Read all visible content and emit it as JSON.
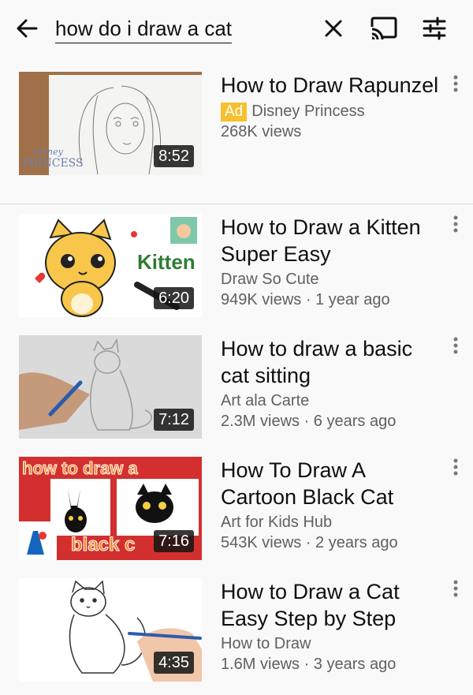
{
  "search": {
    "query": "how do i draw a cat",
    "back_icon": "arrow-back-icon",
    "clear_icon": "close-icon",
    "cast_icon": "cast-icon",
    "filter_icon": "tune-filter-icon"
  },
  "videos": [
    {
      "title": "How to Draw Rapunzel",
      "ad_label": "Ad",
      "channel": "Disney Princess",
      "stats": "268K views",
      "duration": "8:52",
      "thumb_brand": "Disney",
      "thumb_brand_sub": "PRINCESS"
    },
    {
      "title": "How to Draw a Kitten Super Easy",
      "channel": "Draw So Cute",
      "stats": "949K views · 1 year ago",
      "duration": "6:20",
      "thumb_text": "Kitten"
    },
    {
      "title": "How to draw a basic cat sitting",
      "channel": "Art ala Carte",
      "stats": "2.3M views · 6 years ago",
      "duration": "7:12"
    },
    {
      "title": "How To Draw A Cartoon Black Cat",
      "channel": "Art for Kids Hub",
      "stats": "543K views · 2 years ago",
      "duration": "7:16",
      "thumb_text_top": "how to draw a",
      "thumb_text_bottom": "black c"
    },
    {
      "title": "How to Draw a Cat Easy Step by Step",
      "channel": "How to Draw",
      "stats": "1.6M views · 3 years ago",
      "duration": "4:35"
    }
  ],
  "colors": {
    "ad_badge": "#f6c02e",
    "background": "#f9f9f9",
    "secondary_text": "#606060"
  }
}
